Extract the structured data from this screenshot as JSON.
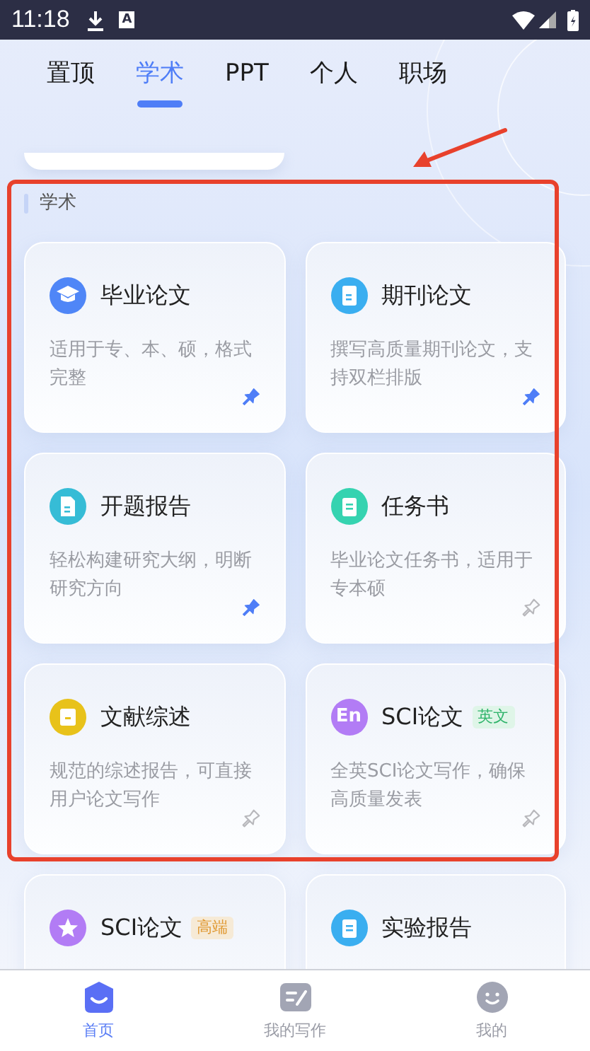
{
  "status_bar": {
    "time": "11:18",
    "notification_letter": "A"
  },
  "tabs": [
    {
      "label": "置顶",
      "selected": false
    },
    {
      "label": "学术",
      "selected": true
    },
    {
      "label": "PPT",
      "selected": false
    },
    {
      "label": "个人",
      "selected": false
    },
    {
      "label": "职场",
      "selected": false
    }
  ],
  "section": {
    "title": "学术"
  },
  "cards": [
    {
      "title": "毕业论文",
      "description": "适用于专、本、硕，格式完整",
      "kind": "cap",
      "color": "#4f86f7",
      "pinned": true
    },
    {
      "title": "期刊论文",
      "description": "撰写高质量期刊论文，支持双栏排版",
      "kind": "book",
      "color": "#3aaef0",
      "pinned": true
    },
    {
      "title": "开题报告",
      "description": "轻松构建研究大纲，明断研究方向",
      "kind": "doc",
      "color": "#36bcd6",
      "pinned": true
    },
    {
      "title": "任务书",
      "description": "毕业论文任务书，适用于专本硕",
      "kind": "clipboard",
      "color": "#35d3b0",
      "pinned": false
    },
    {
      "title": "文献综述",
      "description": "规范的综述报告，可直接用户论文写作",
      "kind": "folder",
      "color": "#e8c21a",
      "pinned": false
    },
    {
      "title": "SCI论文",
      "badge": {
        "label": "英文",
        "kind": "green"
      },
      "description": "全英SCI论文写作，确保高质量发表",
      "kind": "text",
      "icon_text": "En",
      "color": "#b27cf5",
      "pinned": false
    },
    {
      "title": "SCI论文",
      "badge": {
        "label": "高端",
        "kind": "orange"
      },
      "kind": "star",
      "color": "#b27cf5"
    },
    {
      "title": "实验报告",
      "kind": "clipboard",
      "color": "#3aaef0"
    }
  ],
  "bottom_nav": [
    {
      "label": "首页",
      "kind": "home",
      "selected": true
    },
    {
      "label": "我的写作",
      "kind": "write",
      "selected": false
    },
    {
      "label": "我的",
      "kind": "smile",
      "selected": false
    }
  ]
}
